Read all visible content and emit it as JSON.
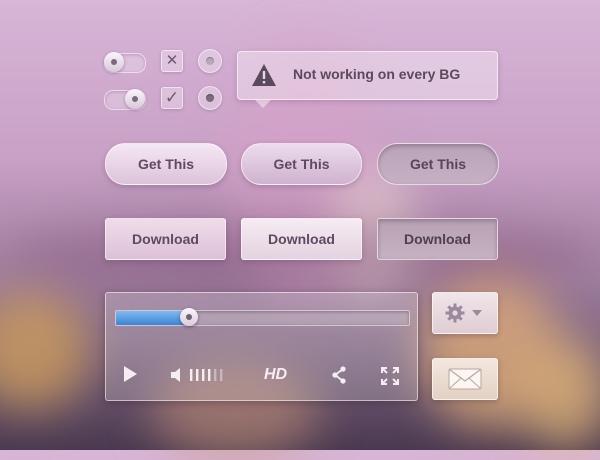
{
  "tooltip": {
    "text": "Not working on every BG"
  },
  "pill_buttons": [
    {
      "label": "Get This",
      "state": "normal"
    },
    {
      "label": "Get This",
      "state": "hover"
    },
    {
      "label": "Get This",
      "state": "pressed"
    }
  ],
  "download_buttons": [
    {
      "label": "Download",
      "state": "normal"
    },
    {
      "label": "Download",
      "state": "hover"
    },
    {
      "label": "Download",
      "state": "pressed"
    }
  ],
  "toggles": [
    {
      "on": false
    },
    {
      "on": true
    }
  ],
  "checkboxes": [
    {
      "mark": "✕"
    },
    {
      "mark": "✓"
    }
  ],
  "radios": [
    {
      "selected": false
    },
    {
      "selected": true
    }
  ],
  "player": {
    "progress": 0.25,
    "hd_label": "HD",
    "volume_bars": 6,
    "volume_level": 4
  },
  "colors": {
    "progress_fill": "#3a84d4",
    "button_text": "#5e4a61"
  },
  "icons": {
    "tooltip": "warning-icon",
    "play": "play-icon",
    "volume": "volume-icon",
    "share": "share-icon",
    "fullscreen": "fullscreen-icon",
    "settings": "gear-icon",
    "dropdown": "caret-down-icon",
    "mail": "mail-icon"
  }
}
